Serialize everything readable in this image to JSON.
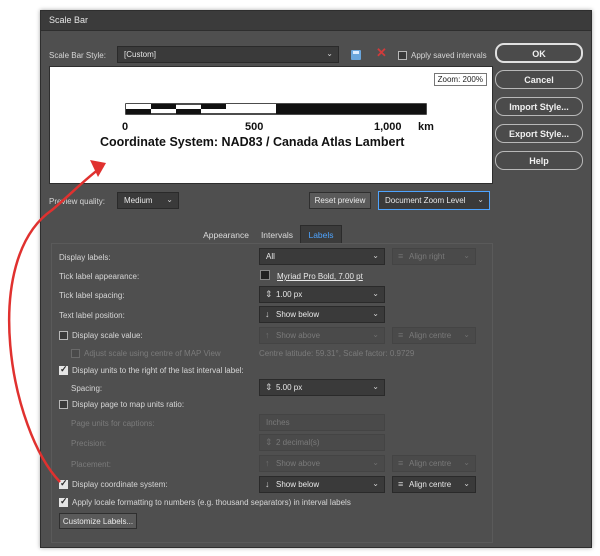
{
  "window": {
    "title": "Scale Bar"
  },
  "header": {
    "style_label": "Scale Bar Style:",
    "style_value": "[Custom]",
    "apply_saved_label": "Apply saved intervals"
  },
  "buttons": {
    "ok": "OK",
    "cancel": "Cancel",
    "import_style": "Import Style...",
    "export_style": "Export Style...",
    "help": "Help",
    "reset_preview": "Reset preview",
    "customize_labels": "Customize Labels..."
  },
  "preview": {
    "zoom_badge": "Zoom: 200%",
    "tick_labels": [
      "0",
      "500",
      "1,000"
    ],
    "units": "km",
    "coordinate_label": "Coordinate System: NAD83 / Canada Atlas Lambert"
  },
  "preview_controls": {
    "quality_label": "Preview quality:",
    "quality_value": "Medium",
    "zoom_mode": "Document Zoom Level"
  },
  "tabs": [
    {
      "label": "Appearance",
      "active": false
    },
    {
      "label": "Intervals",
      "active": false
    },
    {
      "label": "Labels",
      "active": true
    }
  ],
  "labels_tab": {
    "display_labels": {
      "label": "Display labels:",
      "value": "All",
      "align": "Align right"
    },
    "tick_label_appearance": {
      "label": "Tick label appearance:",
      "value": "Myriad Pro Bold, 7.00 pt"
    },
    "tick_label_spacing": {
      "label": "Tick label spacing:",
      "value": "1.00 px"
    },
    "text_label_position": {
      "label": "Text label position:",
      "value": "Show below"
    },
    "display_scale_value": {
      "label": "Display scale value:",
      "position": "Show above",
      "align": "Align centre",
      "checked": false
    },
    "adjust_scale": {
      "label": "Adjust scale using centre of MAP View",
      "info": "Centre latitude: 59.31°, Scale factor: 0.9729"
    },
    "display_units": {
      "label": "Display units to the right of the last interval label:",
      "checked": true
    },
    "spacing": {
      "label": "Spacing:",
      "value": "5.00 px"
    },
    "page_to_map_ratio": {
      "label": "Display page to map units ratio:",
      "checked": false
    },
    "page_units": {
      "label": "Page units for captions:",
      "value": "Inches"
    },
    "precision": {
      "label": "Precision:",
      "value": "2 decimal(s)"
    },
    "placement": {
      "label": "Placement:",
      "position": "Show above",
      "align": "Align centre"
    },
    "display_coordinate_system": {
      "label": "Display coordinate system:",
      "position": "Show below",
      "align": "Align centre",
      "checked": true
    },
    "apply_locale": {
      "label": "Apply locale formatting to numbers (e.g. thousand separators) in interval labels",
      "checked": true
    }
  },
  "colors": {
    "dialog_bg": "#4f4f4f",
    "active_tab_text": "#4ea4ff",
    "annotation_arrow": "#e0312f",
    "delete_icon": "#d03b3b"
  }
}
